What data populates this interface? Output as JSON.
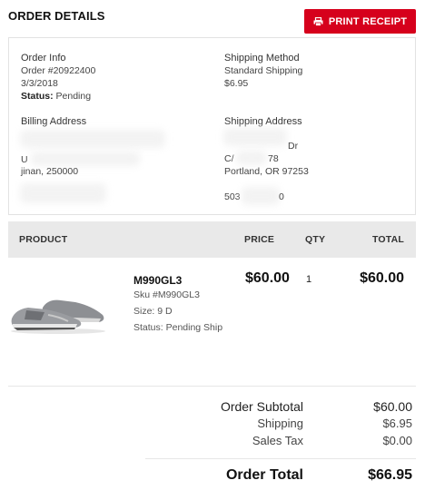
{
  "header": {
    "title": "ORDER DETAILS",
    "print_label": "PRINT RECEIPT"
  },
  "order_info": {
    "heading": "Order Info",
    "order_number": "Order #20922400",
    "date": "3/3/2018",
    "status_label": "Status:",
    "status_value": "Pending"
  },
  "shipping_method": {
    "heading": "Shipping Method",
    "method": "Standard Shipping",
    "cost": "$6.95"
  },
  "billing_address": {
    "heading": "Billing Address",
    "line_partial": "U",
    "city_line": "jinan, 250000"
  },
  "shipping_address": {
    "heading": "Shipping Address",
    "street_partial": "Dr",
    "unit_prefix": "C/",
    "unit_suffix": "78",
    "city_line": "Portland, OR 97253",
    "phone_prefix": "503",
    "phone_suffix": "0"
  },
  "table": {
    "headers": {
      "product": "PRODUCT",
      "price": "PRICE",
      "qty": "QTY",
      "total": "TOTAL"
    }
  },
  "item": {
    "name": "M990GL3",
    "sku": "Sku #M990GL3",
    "size": "Size: 9 D",
    "status": "Status: Pending Ship",
    "price": "$60.00",
    "qty": "1",
    "total": "$60.00"
  },
  "summary": {
    "subtotal_label": "Order Subtotal",
    "subtotal_value": "$60.00",
    "shipping_label": "Shipping",
    "shipping_value": "$6.95",
    "tax_label": "Sales Tax",
    "tax_value": "$0.00",
    "total_label": "Order Total",
    "total_value": "$66.95"
  },
  "colors": {
    "accent": "#d6001c",
    "header_bg": "#e9e9e9"
  }
}
